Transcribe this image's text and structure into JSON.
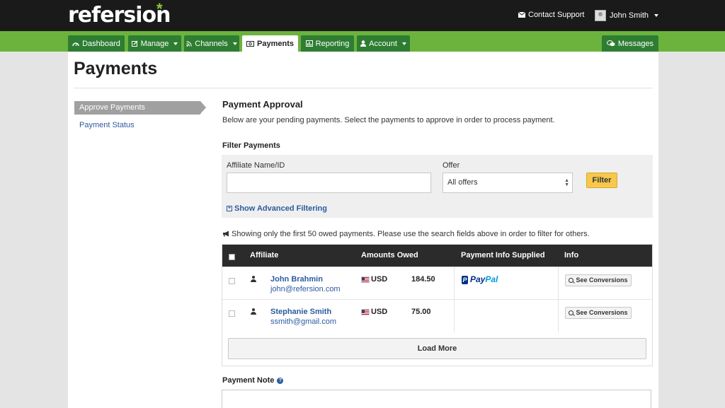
{
  "app": {
    "logo": "refersion",
    "logo_mark": "*"
  },
  "topbar": {
    "contact_label": "Contact Support",
    "user_name": "John Smith"
  },
  "nav": {
    "tabs": [
      {
        "label": "Dashboard",
        "icon": "dashboard-icon",
        "active": false,
        "dropdown": false
      },
      {
        "label": "Manage",
        "icon": "edit-icon",
        "active": false,
        "dropdown": true
      },
      {
        "label": "Channels",
        "icon": "rss-icon",
        "active": false,
        "dropdown": true
      },
      {
        "label": "Payments",
        "icon": "money-icon",
        "active": true,
        "dropdown": false
      },
      {
        "label": "Reporting",
        "icon": "bar-chart-icon",
        "active": false,
        "dropdown": false
      },
      {
        "label": "Account",
        "icon": "user-icon",
        "active": false,
        "dropdown": true
      }
    ],
    "messages_label": "Messages"
  },
  "page": {
    "title": "Payments"
  },
  "sidebar": {
    "items": [
      {
        "label": "Approve Payments",
        "active": true
      },
      {
        "label": "Payment Status",
        "active": false
      }
    ]
  },
  "main": {
    "section_title": "Payment Approval",
    "section_desc": "Below are your pending payments. Select the payments to approve in order to process payment.",
    "filter": {
      "title": "Filter Payments",
      "affiliate_label": "Affiliate Name/ID",
      "affiliate_value": "",
      "offer_label": "Offer",
      "offer_selected": "All offers",
      "button_label": "Filter",
      "advanced_label": "Show Advanced Filtering"
    },
    "notice": "Showing only the first 50 owed payments. Please use the search fields above in order to filter for others.",
    "table": {
      "headers": [
        "Affiliate",
        "Amounts Owed",
        "Payment Info Supplied",
        "Info"
      ],
      "rows": [
        {
          "name": "John Brahmin",
          "email": "john@refersion.com",
          "currency": "USD",
          "amount": "184.50",
          "payment_info": "PayPal",
          "action": "See Conversions"
        },
        {
          "name": "Stephanie Smith",
          "email": "ssmith@gmail.com",
          "currency": "USD",
          "amount": "75.00",
          "payment_info": "",
          "action": "See Conversions"
        }
      ],
      "load_more": "Load More"
    },
    "payment_note_label": "Payment Note"
  },
  "colors": {
    "topbar": "#1a1a1a",
    "nav_green": "#6cb33e",
    "tab_green": "#2e7d32",
    "link_blue": "#2c5aa0",
    "filter_button": "#f7c84c"
  }
}
